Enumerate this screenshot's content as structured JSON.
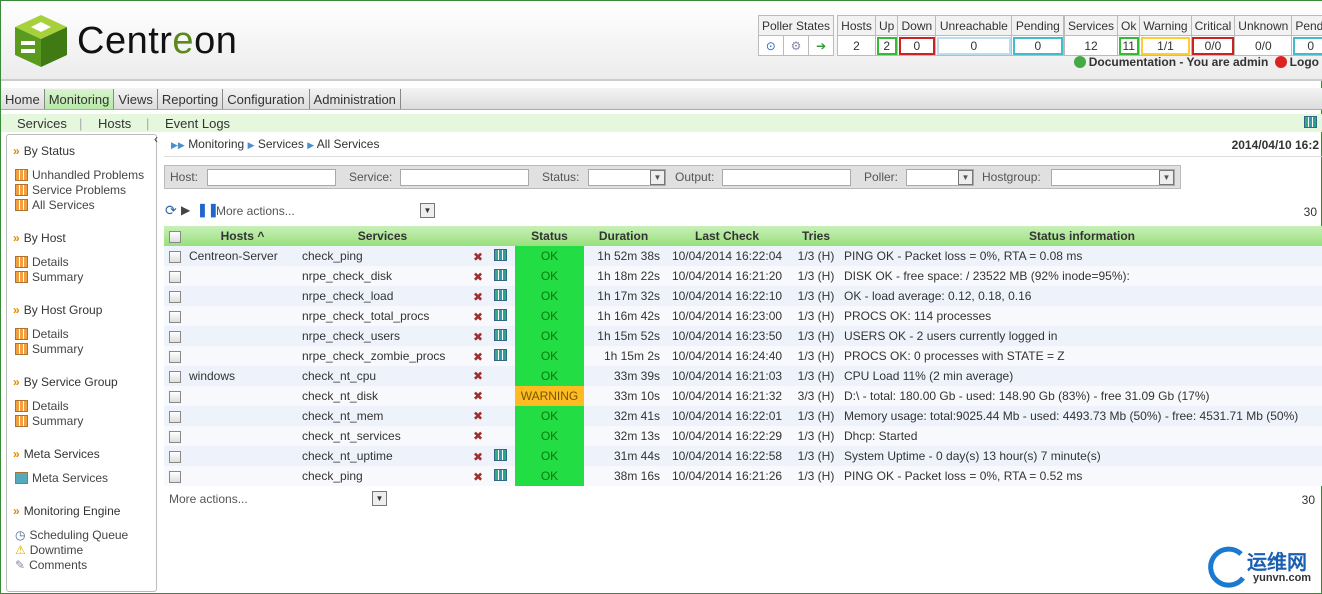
{
  "app": {
    "logo_text_pre": "Centr",
    "logo_text_e": "e",
    "logo_text_post": "on"
  },
  "poller": {
    "label": "Poller States",
    "icons": [
      "poller-status-icon",
      "poller-gear-icon",
      "poller-db-icon"
    ]
  },
  "hosts_summary": {
    "headers": [
      "Hosts",
      "Up",
      "Down",
      "Unreachable",
      "Pending"
    ],
    "values": [
      "2",
      "2",
      "0",
      "0",
      "0"
    ]
  },
  "services_summary": {
    "headers": [
      "Services",
      "Ok",
      "Warning",
      "Critical",
      "Unknown",
      "Pendi"
    ],
    "values": [
      "12",
      "11",
      "1/1",
      "0/0",
      "0/0",
      "0"
    ]
  },
  "user_bar": {
    "documentation": "Documentation",
    "you_are": "- You are admin",
    "logout": "Logo"
  },
  "menu": [
    "Home",
    "Monitoring",
    "Views",
    "Reporting",
    "Configuration",
    "Administration"
  ],
  "submenu": [
    "Services",
    "|",
    "Hosts",
    "|",
    "Event Logs"
  ],
  "sidebar": {
    "sections": [
      {
        "title": "By Status",
        "items": [
          "Unhandled Problems",
          "Service Problems",
          "All Services"
        ]
      },
      {
        "title": "By Host",
        "items": [
          "Details",
          "Summary"
        ]
      },
      {
        "title": "By Host Group",
        "items": [
          "Details",
          "Summary"
        ]
      },
      {
        "title": "By Service Group",
        "items": [
          "Details",
          "Summary"
        ]
      },
      {
        "title": "Meta Services",
        "items": [
          "Meta Services"
        ]
      },
      {
        "title": "Monitoring Engine",
        "items": [
          "Scheduling Queue",
          "Downtime",
          "Comments"
        ]
      }
    ]
  },
  "breadcrumb": [
    "Monitoring",
    "Services",
    "All Services"
  ],
  "date": "2014/04/10 16:2",
  "filters": {
    "host": "Host:",
    "service": "Service:",
    "status": "Status:",
    "output": "Output:",
    "poller": "Poller:",
    "hostgroup": "Hostgroup:"
  },
  "actions": {
    "more": "More actions...",
    "count": "30"
  },
  "table": {
    "headers": [
      "Hosts",
      "Services",
      "Status",
      "Duration",
      "Last Check",
      "Tries",
      "Status information"
    ],
    "rows": [
      {
        "host": "Centreon-Server",
        "service": "check_ping",
        "graph": true,
        "status": "OK",
        "duration": "1h 52m 38s",
        "last": "10/04/2014 16:22:04",
        "tries": "1/3 (H)",
        "info": "PING OK - Packet loss = 0%, RTA = 0.08 ms"
      },
      {
        "host": "",
        "service": "nrpe_check_disk",
        "graph": true,
        "status": "OK",
        "duration": "1h 18m 22s",
        "last": "10/04/2014 16:21:20",
        "tries": "1/3 (H)",
        "info": "DISK OK - free space: / 23522 MB (92% inode=95%):"
      },
      {
        "host": "",
        "service": "nrpe_check_load",
        "graph": true,
        "status": "OK",
        "duration": "1h 17m 32s",
        "last": "10/04/2014 16:22:10",
        "tries": "1/3 (H)",
        "info": "OK - load average: 0.12, 0.18, 0.16"
      },
      {
        "host": "",
        "service": "nrpe_check_total_procs",
        "graph": true,
        "status": "OK",
        "duration": "1h 16m 42s",
        "last": "10/04/2014 16:23:00",
        "tries": "1/3 (H)",
        "info": "PROCS OK: 114 processes"
      },
      {
        "host": "",
        "service": "nrpe_check_users",
        "graph": true,
        "status": "OK",
        "duration": "1h 15m 52s",
        "last": "10/04/2014 16:23:50",
        "tries": "1/3 (H)",
        "info": "USERS OK - 2 users currently logged in"
      },
      {
        "host": "",
        "service": "nrpe_check_zombie_procs",
        "graph": true,
        "status": "OK",
        "duration": "1h 15m 2s",
        "last": "10/04/2014 16:24:40",
        "tries": "1/3 (H)",
        "info": "PROCS OK: 0 processes with STATE = Z"
      },
      {
        "host": "windows",
        "service": "check_nt_cpu",
        "graph": false,
        "status": "OK",
        "duration": "33m 39s",
        "last": "10/04/2014 16:21:03",
        "tries": "1/3 (H)",
        "info": "CPU Load 11% (2 min average)"
      },
      {
        "host": "",
        "service": "check_nt_disk",
        "graph": false,
        "status": "WARNING",
        "duration": "33m 10s",
        "last": "10/04/2014 16:21:32",
        "tries": "3/3 (H)",
        "info": "D:\\ - total: 180.00 Gb - used: 148.90 Gb (83%) - free 31.09 Gb (17%)"
      },
      {
        "host": "",
        "service": "check_nt_mem",
        "graph": false,
        "status": "OK",
        "duration": "32m 41s",
        "last": "10/04/2014 16:22:01",
        "tries": "1/3 (H)",
        "info": "Memory usage: total:9025.44 Mb - used: 4493.73 Mb (50%) - free: 4531.71 Mb (50%)"
      },
      {
        "host": "",
        "service": "check_nt_services",
        "graph": false,
        "status": "OK",
        "duration": "32m 13s",
        "last": "10/04/2014 16:22:29",
        "tries": "1/3 (H)",
        "info": "Dhcp: Started"
      },
      {
        "host": "",
        "service": "check_nt_uptime",
        "graph": true,
        "status": "OK",
        "duration": "31m 44s",
        "last": "10/04/2014 16:22:58",
        "tries": "1/3 (H)",
        "info": "System Uptime - 0 day(s) 13 hour(s) 7 minute(s)"
      },
      {
        "host": "",
        "service": "check_ping",
        "graph": true,
        "status": "OK",
        "duration": "38m 16s",
        "last": "10/04/2014 16:21:26",
        "tries": "1/3 (H)",
        "info": "PING OK - Packet loss = 0%, RTA = 0.52 ms"
      }
    ]
  },
  "watermark": {
    "cn": "运维网",
    "url": "yunvn.com"
  },
  "colors": {
    "ok": "#22dd44",
    "warning": "#ffbb22",
    "header_green": "#98e07c"
  }
}
